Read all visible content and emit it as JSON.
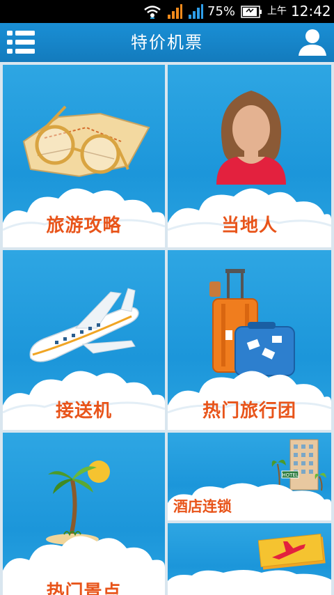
{
  "status_bar": {
    "battery_percent": "75%",
    "am_pm": "上午",
    "time": "12:42"
  },
  "app_bar": {
    "title": "特价机票",
    "menu_icon": "list-menu-icon",
    "user_icon": "user-profile-icon"
  },
  "tiles": [
    {
      "label": "旅游攻略",
      "icon": "map-glasses-icon"
    },
    {
      "label": "当地人",
      "icon": "woman-avatar-icon"
    },
    {
      "label": "接送机",
      "icon": "airplane-icon"
    },
    {
      "label": "热门旅行团",
      "icon": "luggage-icon"
    },
    {
      "label": "热门景点",
      "icon": "palm-island-icon"
    },
    {
      "label": "酒店连锁",
      "icon": "hotel-building-icon"
    },
    {
      "label": "",
      "icon": "flight-ticket-icon"
    }
  ],
  "hotel_sign": "HOTEL",
  "colors": {
    "app_bar": "#137bbd",
    "tile_bg": "#1c96da",
    "label": "#e8541a"
  }
}
